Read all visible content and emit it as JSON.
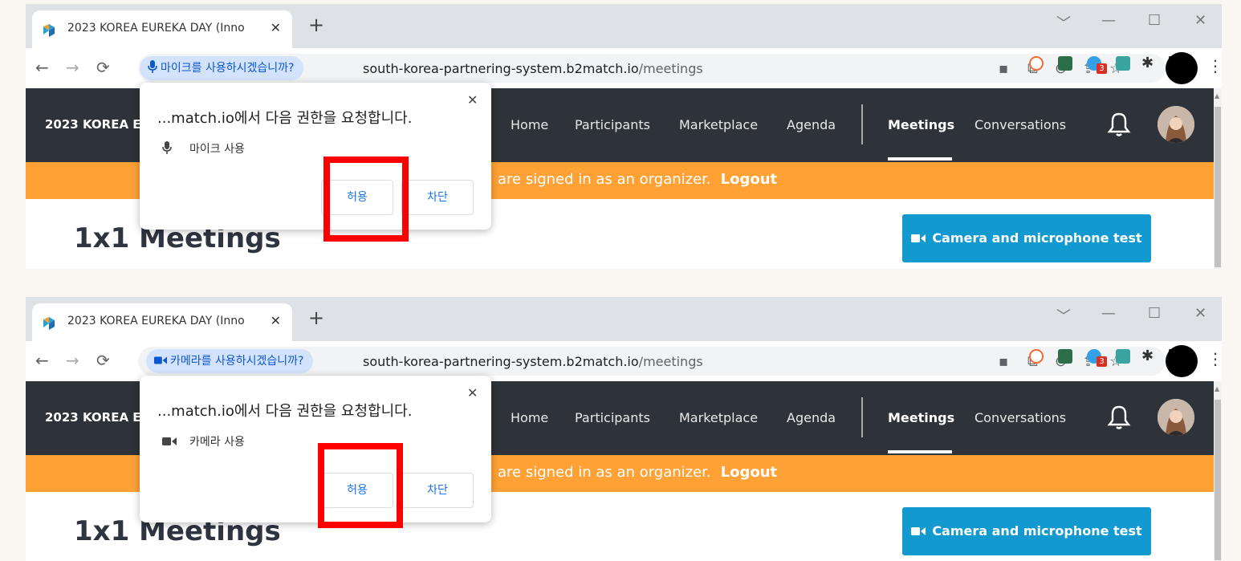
{
  "browser": {
    "tab_title": "2023 KOREA EUREKA DAY (Inno",
    "tab_close": "✕",
    "new_tab": "+",
    "window_controls": [
      "﹀",
      "—",
      "☐",
      "✕"
    ],
    "url_host": "south-korea-partnering-system.b2match.io",
    "url_path": "/meetings",
    "extension_badge": "3"
  },
  "site": {
    "brand": "2023 KOREA EU",
    "nav": [
      "Home",
      "Participants",
      "Marketplace",
      "Agenda"
    ],
    "nav_active": "Meetings",
    "nav_last": "Conversations",
    "banner_text": "are signed in as an organizer.",
    "banner_link": "Logout",
    "page_title": "1x1 Meetings",
    "camera_button": "Camera and microphone test"
  },
  "popup": {
    "title": "...match.io에서 다음 권한을 요청합니다.",
    "close": "✕",
    "allow": "허용",
    "block": "차단"
  },
  "screens": [
    {
      "chip_label": "마이크를 사용하시겠습니까?",
      "chip_icon": "microphone-icon",
      "permission_label": "마이크 사용"
    },
    {
      "chip_label": "카메라를 사용하시겠습니까?",
      "chip_icon": "camera-icon",
      "permission_label": "카메라 사용"
    }
  ],
  "colors": {
    "nav_bg": "#2e3339",
    "banner": "#ffa135",
    "camera_button": "#1299cf",
    "highlight": "#ff0000",
    "chip_bg": "#d3e3fd"
  }
}
